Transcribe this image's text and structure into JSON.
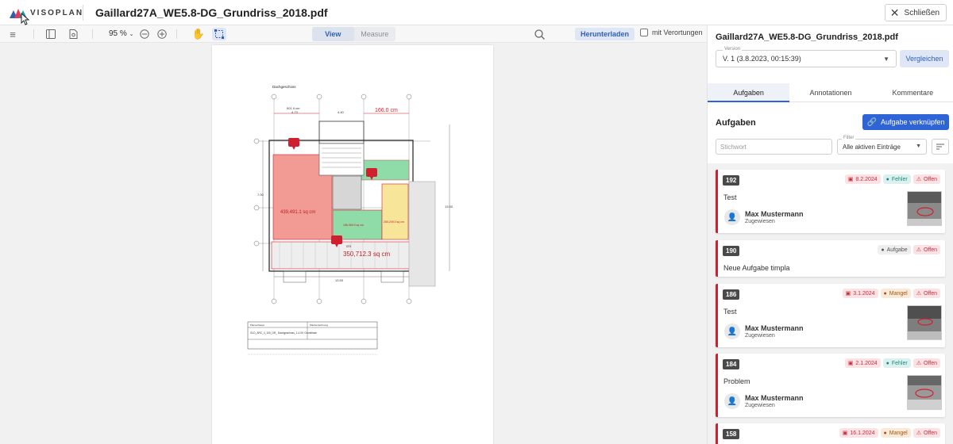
{
  "app": {
    "logo_text": "VISOPLAN",
    "document_title": "Gaillard27A_WE5.8-DG_Grundriss_2018.pdf",
    "close_label": "Schließen"
  },
  "toolbar": {
    "zoom": "95 %",
    "view_label": "View",
    "measure_label": "Measure",
    "download_label": "Herunterladen",
    "locations_label": "mit Verortungen"
  },
  "plan": {
    "floor_label": "Dachgeschoss",
    "dim_top_1": "501.9 cm",
    "dim_top_2": "4.73",
    "dim_top_3": "4.40",
    "dim_top_4": "166.0 cm",
    "area_big": "439,491.1 sq cm",
    "area_green": "186,969.9 sq cm",
    "area_yellow": "250,209.0 sq cm",
    "area_bottom": "350,712.3 sq cm",
    "dim_bottom_label": "cm",
    "dim_bottom": "13.50",
    "dim_side": "13.50",
    "dim_left": "7.00",
    "title_block_1": "Planverfasser",
    "title_block_2": "Planbezeichnung",
    "title_block_3": "GLD_ARC_4_100_GR_ Dachgeschoss_1-4.00: Grundrisse"
  },
  "panel": {
    "title": "Gaillard27A_WE5.8-DG_Grundriss_2018.pdf",
    "version_label": "Version",
    "version_value": "V. 1 (3.8.2023, 00:15:39)",
    "compare_label": "Vergleichen",
    "tabs": [
      "Aufgaben",
      "Annotationen",
      "Kommentare"
    ],
    "section_title": "Aufgaben",
    "link_button": "Aufgabe verknüpfen",
    "search_placeholder": "Stichwort",
    "filter_label": "Filter",
    "filter_value": "Alle aktiven Einträge"
  },
  "tasks": [
    {
      "id": "192",
      "date": "8.2.2024",
      "type": "Fehler",
      "status": "Offen",
      "title": "Test",
      "assignee": "Max Mustermann",
      "role": "Zugewiesen"
    },
    {
      "id": "190",
      "type": "Aufgabe",
      "status": "Offen",
      "title": "Neue Aufgabe timpla"
    },
    {
      "id": "186",
      "date": "3.1.2024",
      "type": "Mangel",
      "status": "Offen",
      "title": "Test",
      "assignee": "Max Mustermann",
      "role": "Zugewiesen"
    },
    {
      "id": "184",
      "date": "2.1.2024",
      "type": "Fehler",
      "status": "Offen",
      "title": "Problem",
      "assignee": "Max Mustermann",
      "role": "Zugewiesen"
    },
    {
      "id": "158",
      "date": "16.1.2024",
      "type": "Mangel",
      "status": "Offen"
    }
  ],
  "colors": {
    "accent": "#2f64d6",
    "task_bar": "#d0202f",
    "area_red": "#f29a94",
    "area_green": "#8fdca8",
    "area_yellow": "#f7e59a"
  }
}
